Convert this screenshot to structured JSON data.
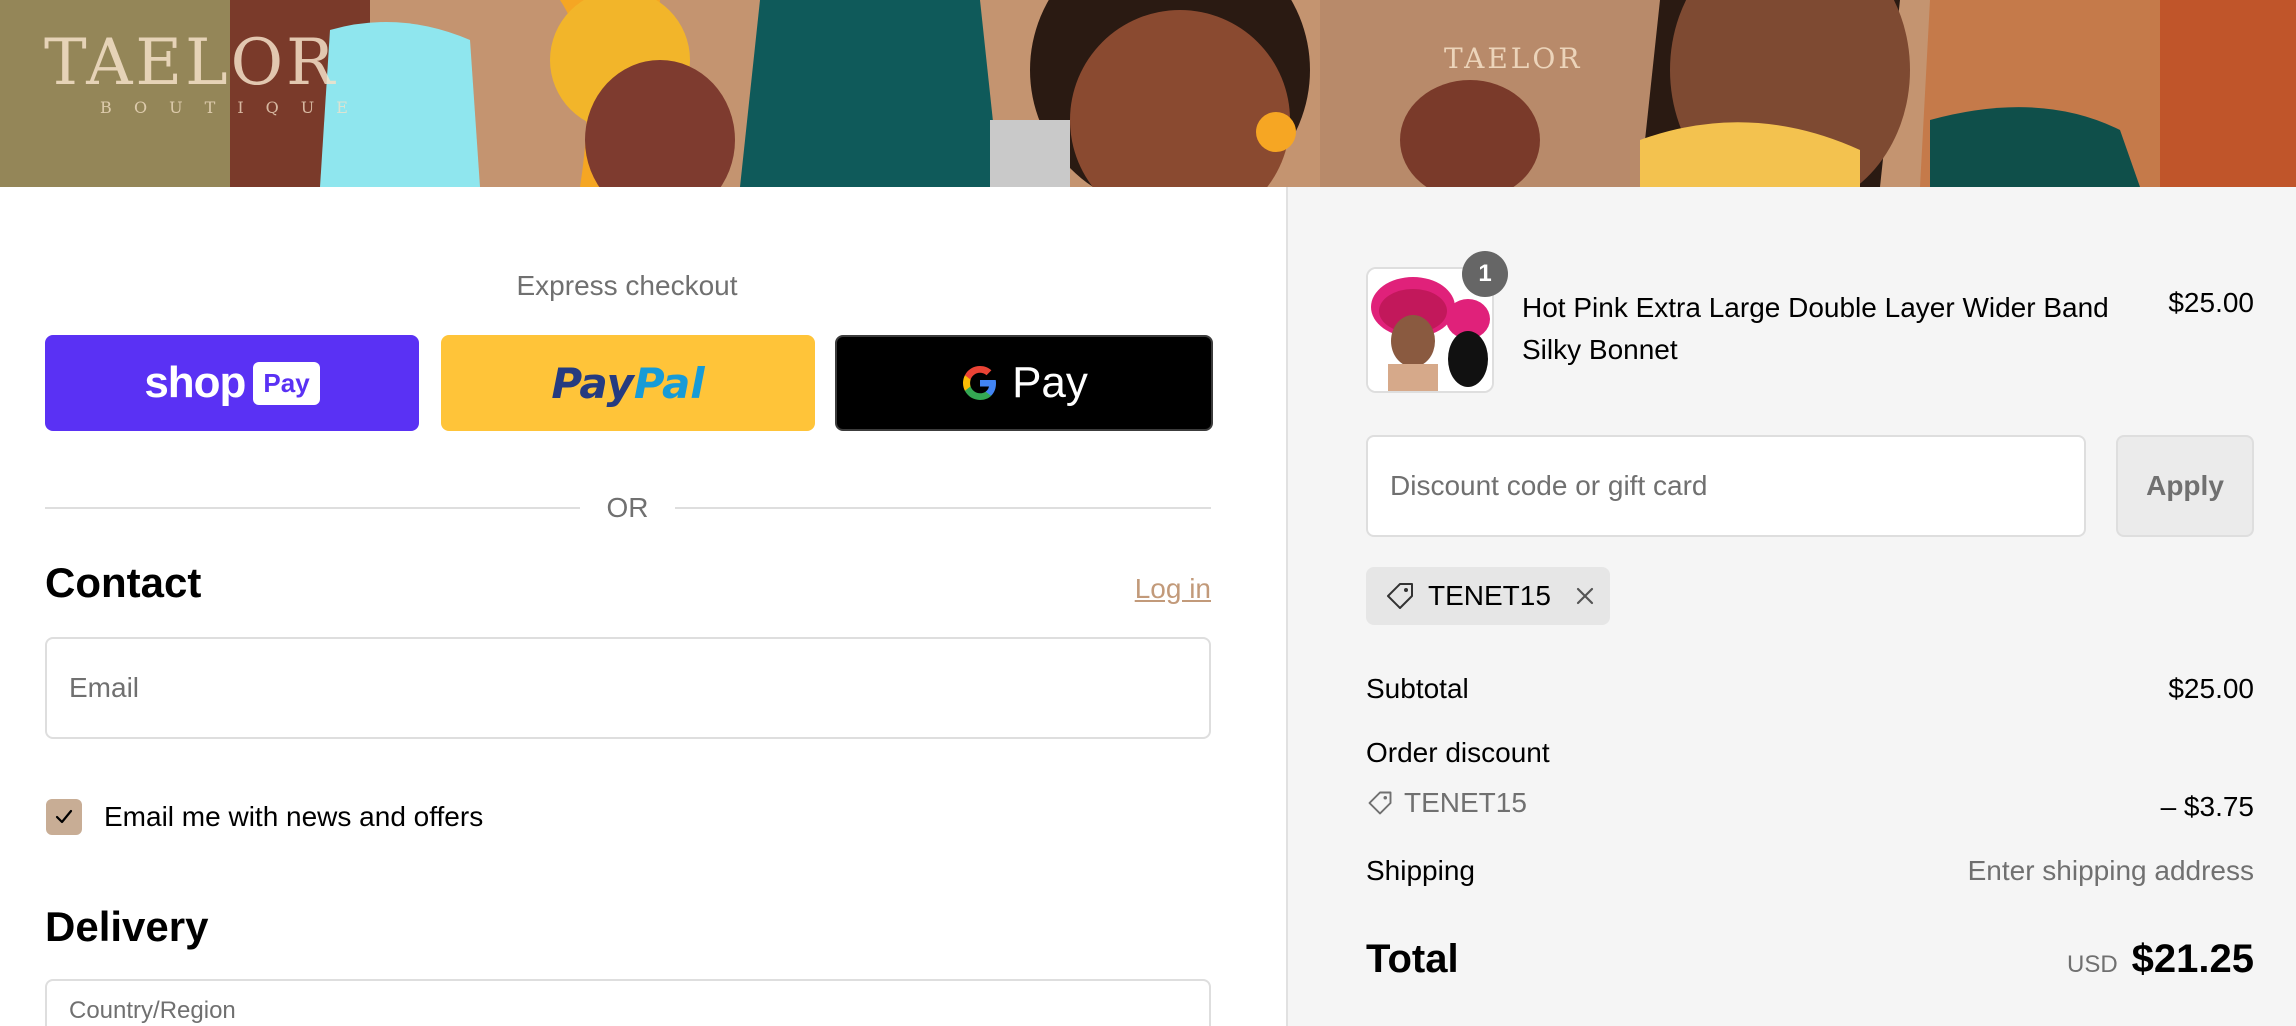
{
  "banner": {
    "brand_main": "TAELOR",
    "brand_sub": "BOUTIQUE",
    "brand_small": "TAELOR"
  },
  "express": {
    "title": "Express checkout",
    "shop_pay": {
      "shop": "shop",
      "pay": "Pay"
    },
    "paypal": {
      "part1": "Pay",
      "part2": "Pal"
    },
    "gpay": {
      "label": "Pay"
    },
    "or": "OR"
  },
  "contact": {
    "title": "Contact",
    "login": "Log in",
    "email_placeholder": "Email",
    "newsletter_label": "Email me with news and offers",
    "newsletter_checked": true
  },
  "delivery": {
    "title": "Delivery",
    "country_label": "Country/Region"
  },
  "cart": {
    "quantity": "1",
    "product_name": "Hot Pink Extra Large Double Layer Wider Band Silky Bonnet",
    "product_price": "$25.00"
  },
  "discount": {
    "placeholder": "Discount code or gift card",
    "apply": "Apply",
    "applied_code": "TENET15"
  },
  "summary": {
    "subtotal_label": "Subtotal",
    "subtotal_value": "$25.00",
    "order_discount_label": "Order discount",
    "discount_code": "TENET15",
    "discount_value": "– $3.75",
    "shipping_label": "Shipping",
    "shipping_value": "Enter shipping address",
    "total_label": "Total",
    "total_currency": "USD",
    "total_value": "$21.25"
  },
  "colors": {
    "shop_pay": "#5a31f4",
    "paypal": "#ffc439",
    "gpay": "#000000",
    "accent_link": "#c29a7a",
    "checkbox": "#c8ad95"
  }
}
